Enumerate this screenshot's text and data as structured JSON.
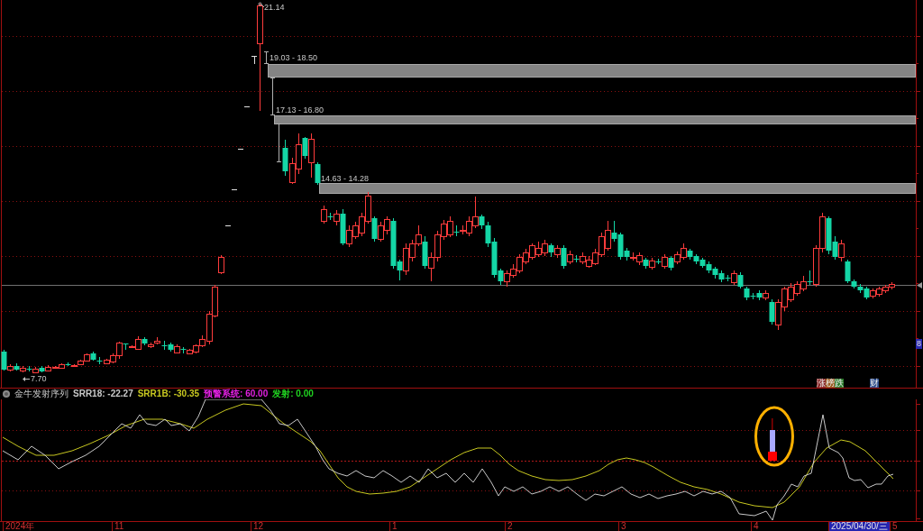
{
  "main_chart": {
    "price_marks": [
      {
        "kind": "high",
        "text": "21.14"
      },
      {
        "kind": "low",
        "text": "7.70"
      }
    ],
    "gap_zones": [
      {
        "label": "19.03 - 18.50"
      },
      {
        "label": "17.13 - 16.80"
      },
      {
        "label": "14.63 - 14.28"
      }
    ],
    "event_markers": [
      {
        "text": "涨",
        "color": "#8a2a2a"
      },
      {
        "text": "榜",
        "color": "#9a5a20"
      },
      {
        "text": "跌",
        "color": "#2a7a2a"
      },
      {
        "text": "财",
        "color": "#2a4a8a"
      }
    ],
    "axis_tag": "8"
  },
  "indicator": {
    "name": "金牛发射序列",
    "legend": [
      {
        "label": "SRR18:",
        "value": "-22.27",
        "color": "#c8c8c8"
      },
      {
        "label": "SRR1B:",
        "value": "-30.35",
        "color": "#c8c820"
      },
      {
        "label": "预警系统:",
        "value": "60.00",
        "color": "#e020e0"
      },
      {
        "label": "发射:",
        "value": "0.00",
        "color": "#20d020"
      }
    ]
  },
  "time_axis": {
    "labels": [
      {
        "text": "2024年",
        "selected": false
      },
      {
        "text": "11",
        "selected": false
      },
      {
        "text": "12",
        "selected": false
      },
      {
        "text": "1",
        "selected": false
      },
      {
        "text": "2",
        "selected": false
      },
      {
        "text": "3",
        "selected": false
      },
      {
        "text": "4",
        "selected": false
      },
      {
        "text": "2025/04/30/三",
        "selected": true
      },
      {
        "text": "5",
        "selected": false
      }
    ]
  }
}
